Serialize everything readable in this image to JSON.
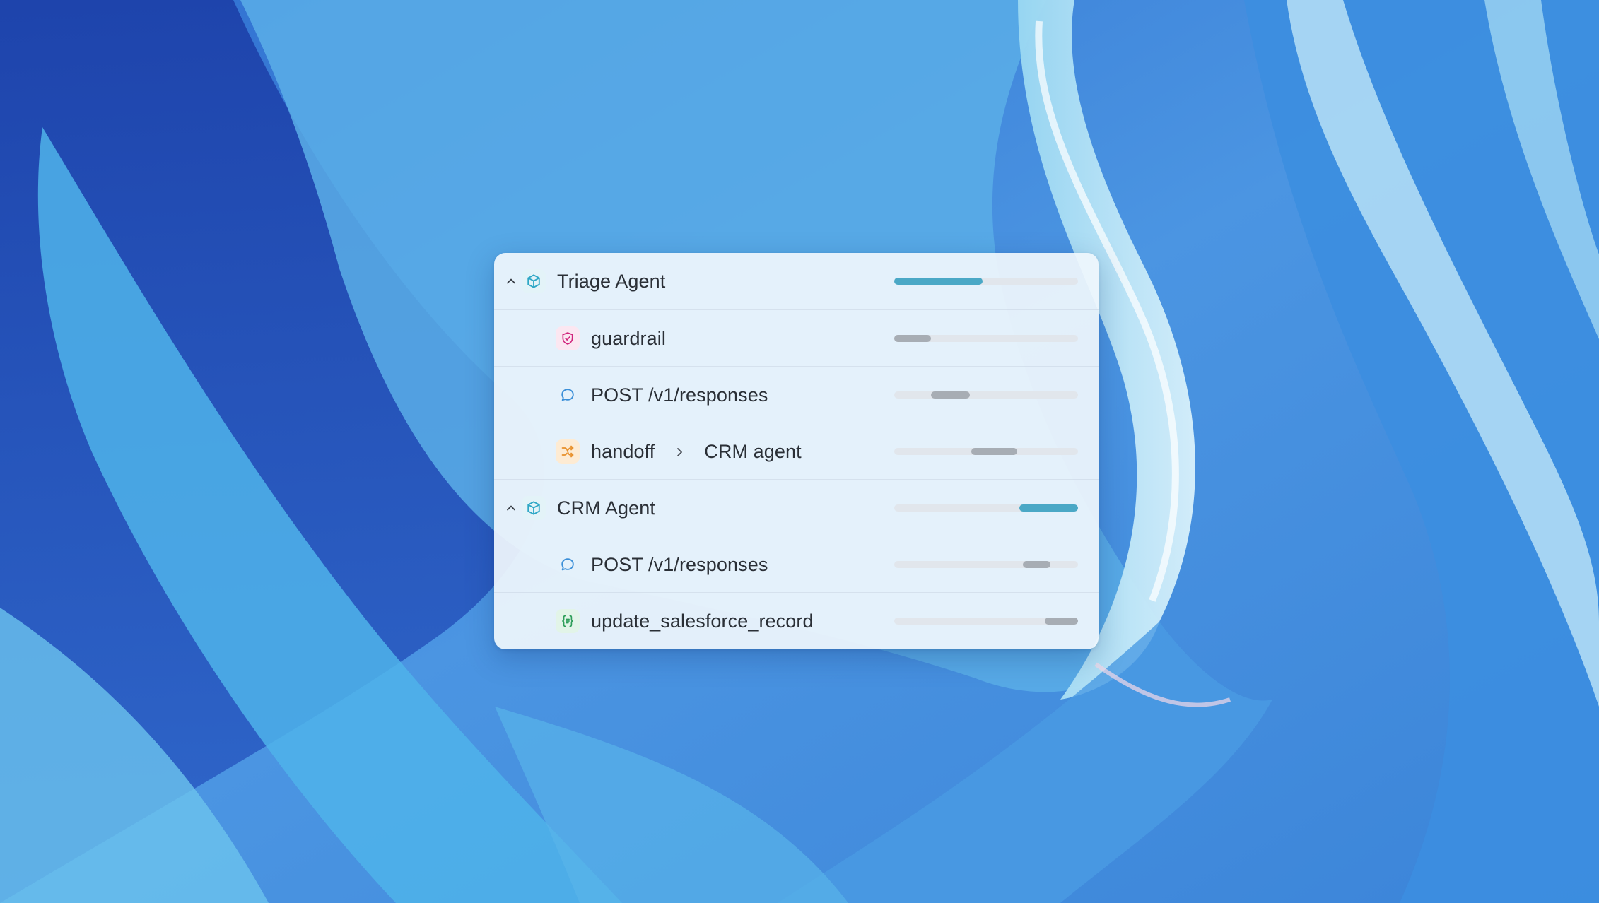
{
  "colors": {
    "accent": "#4aa8c6",
    "muted_bar": "#a7adb4",
    "track": "#e1e6ec",
    "agent_icon": "#2ea7c6",
    "guardrail_icon": "#d0247c",
    "response_icon": "#3b8fd8",
    "handoff_icon": "#e8902a",
    "function_icon": "#2e9e5a"
  },
  "trace": {
    "rows": [
      {
        "label": "Triage Agent",
        "kind": "agent",
        "icon": "cube-icon",
        "expanded": true,
        "bar": {
          "start": 0.0,
          "end": 0.48,
          "style": "accent"
        }
      },
      {
        "label": "guardrail",
        "kind": "guardrail",
        "icon": "shield-check-icon",
        "bar": {
          "start": 0.0,
          "end": 0.2,
          "style": "muted"
        }
      },
      {
        "label": "POST /v1/responses",
        "kind": "response",
        "icon": "chat-bubble-icon",
        "bar": {
          "start": 0.2,
          "end": 0.41,
          "style": "muted"
        }
      },
      {
        "label": "handoff",
        "target": "CRM agent",
        "kind": "handoff",
        "icon": "shuffle-icon",
        "separator_icon": "chevron-right-icon",
        "bar": {
          "start": 0.42,
          "end": 0.67,
          "style": "muted"
        }
      },
      {
        "label": "CRM Agent",
        "kind": "agent",
        "icon": "cube-icon",
        "expanded": true,
        "bar": {
          "start": 0.68,
          "end": 1.0,
          "style": "accent"
        }
      },
      {
        "label": "POST /v1/responses",
        "kind": "response",
        "icon": "chat-bubble-icon",
        "bar": {
          "start": 0.7,
          "end": 0.85,
          "style": "muted"
        }
      },
      {
        "label": "update_salesforce_record",
        "kind": "function",
        "icon": "function-braces-icon",
        "bar": {
          "start": 0.82,
          "end": 1.0,
          "style": "muted"
        }
      }
    ]
  }
}
